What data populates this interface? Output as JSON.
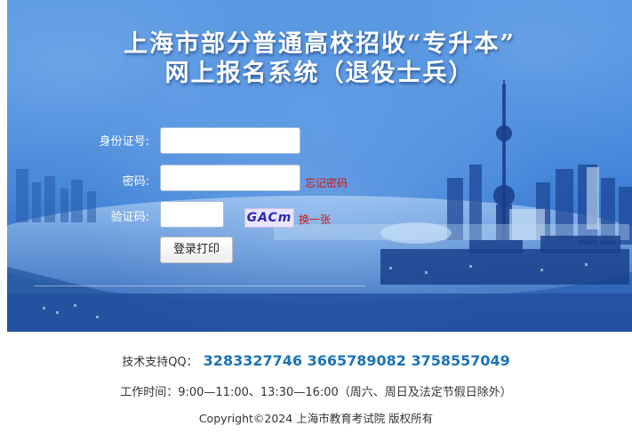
{
  "header": {
    "title_line1": "上海市部分普通高校招收“专升本”",
    "title_line2": "网上报名系统（退役士兵）"
  },
  "form": {
    "id_label": "身份证号:",
    "id_value": "",
    "password_label": "密码:",
    "password_value": "",
    "forgot_password": "忘记密码",
    "captcha_label": "验证码:",
    "captcha_value": "",
    "captcha_text": "GACm",
    "refresh_captcha": "换一张",
    "login_button": "登录打印"
  },
  "footer": {
    "support_label": "技术支持QQ：",
    "support_numbers": "3283327746 3665789082 3758557049",
    "work_time": "工作时间：9:00—11:00、13:30—16:00（周六、周日及法定节假日除外）",
    "copyright": "Copyright©2024 上海市教育考试院 版权所有"
  },
  "colors": {
    "banner_blue": "#3f86dd",
    "link_red": "#d81414",
    "qq_blue": "#1a73b8"
  }
}
